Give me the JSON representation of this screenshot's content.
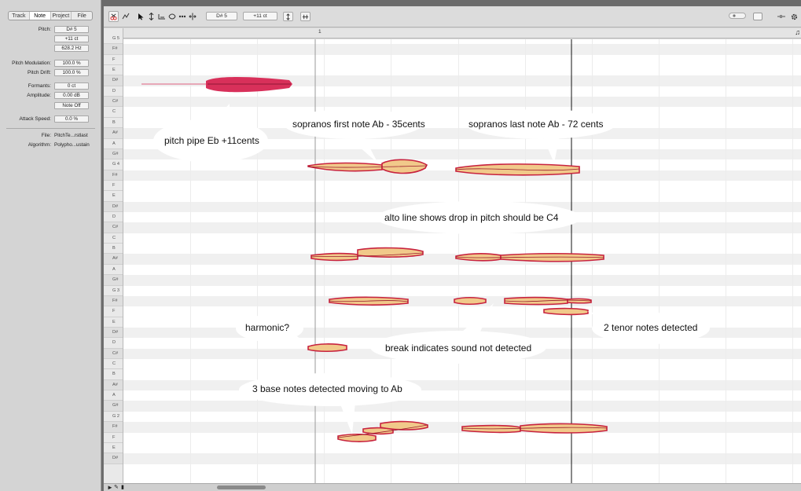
{
  "inspector": {
    "tabs": [
      "Track",
      "Note",
      "Project",
      "File"
    ],
    "active_tab": "Note",
    "pitch_label": "Pitch:",
    "pitch_note": "D# 5",
    "pitch_cents": "+11 ct",
    "pitch_hz": "628.2 Hz",
    "pitch_mod_label": "Pitch Modulation:",
    "pitch_mod_value": "100.0 %",
    "pitch_drift_label": "Pitch Drift:",
    "pitch_drift_value": "100.0 %",
    "formants_label": "Formants:",
    "formants_value": "0 ct",
    "amplitude_label": "Amplitude:",
    "amplitude_value": "0.00 dB",
    "note_off_label": "Note Off",
    "attack_label": "Attack Speed:",
    "attack_value": "0.0 %",
    "file_label": "File:",
    "file_value": "PitchTe...rstlast",
    "algorithm_label": "Algorithm:",
    "algorithm_value": "Polypho...ustain"
  },
  "toolbar": {
    "note_field": "D# 5",
    "cents_field": "+11 ct"
  },
  "ruler": {
    "bar_number": "1"
  },
  "piano_keys": [
    "G 5",
    "F#",
    "F",
    "E",
    "D#",
    "D",
    "C#",
    "C",
    "B",
    "A#",
    "A",
    "G#",
    "G 4",
    "F#",
    "F",
    "E",
    "D#",
    "D",
    "C#",
    "C",
    "B",
    "A#",
    "A",
    "G#",
    "G 3",
    "F#",
    "F",
    "E",
    "D#",
    "D",
    "C#",
    "C",
    "B",
    "A#",
    "A",
    "G#",
    "G 2",
    "F#",
    "F",
    "E",
    "D#"
  ],
  "annotations": {
    "pitch_pipe": "pitch pipe Eb +11cents",
    "sopranos_first": "sopranos first note Ab - 35cents",
    "sopranos_last": "sopranos last note Ab - 72 cents",
    "alto_line": "alto line shows drop in pitch should be C4",
    "harmonic": "harmonic?",
    "break": "break indicates sound not detected",
    "tenor": "2 tenor notes detected",
    "bass": "3 base notes detected moving to Ab"
  },
  "colors": {
    "blob_fill": "#f1c98a",
    "blob_edge": "#c8233f",
    "selected_blob": "#d8305a",
    "lane_dark": "#f0f0f0"
  }
}
